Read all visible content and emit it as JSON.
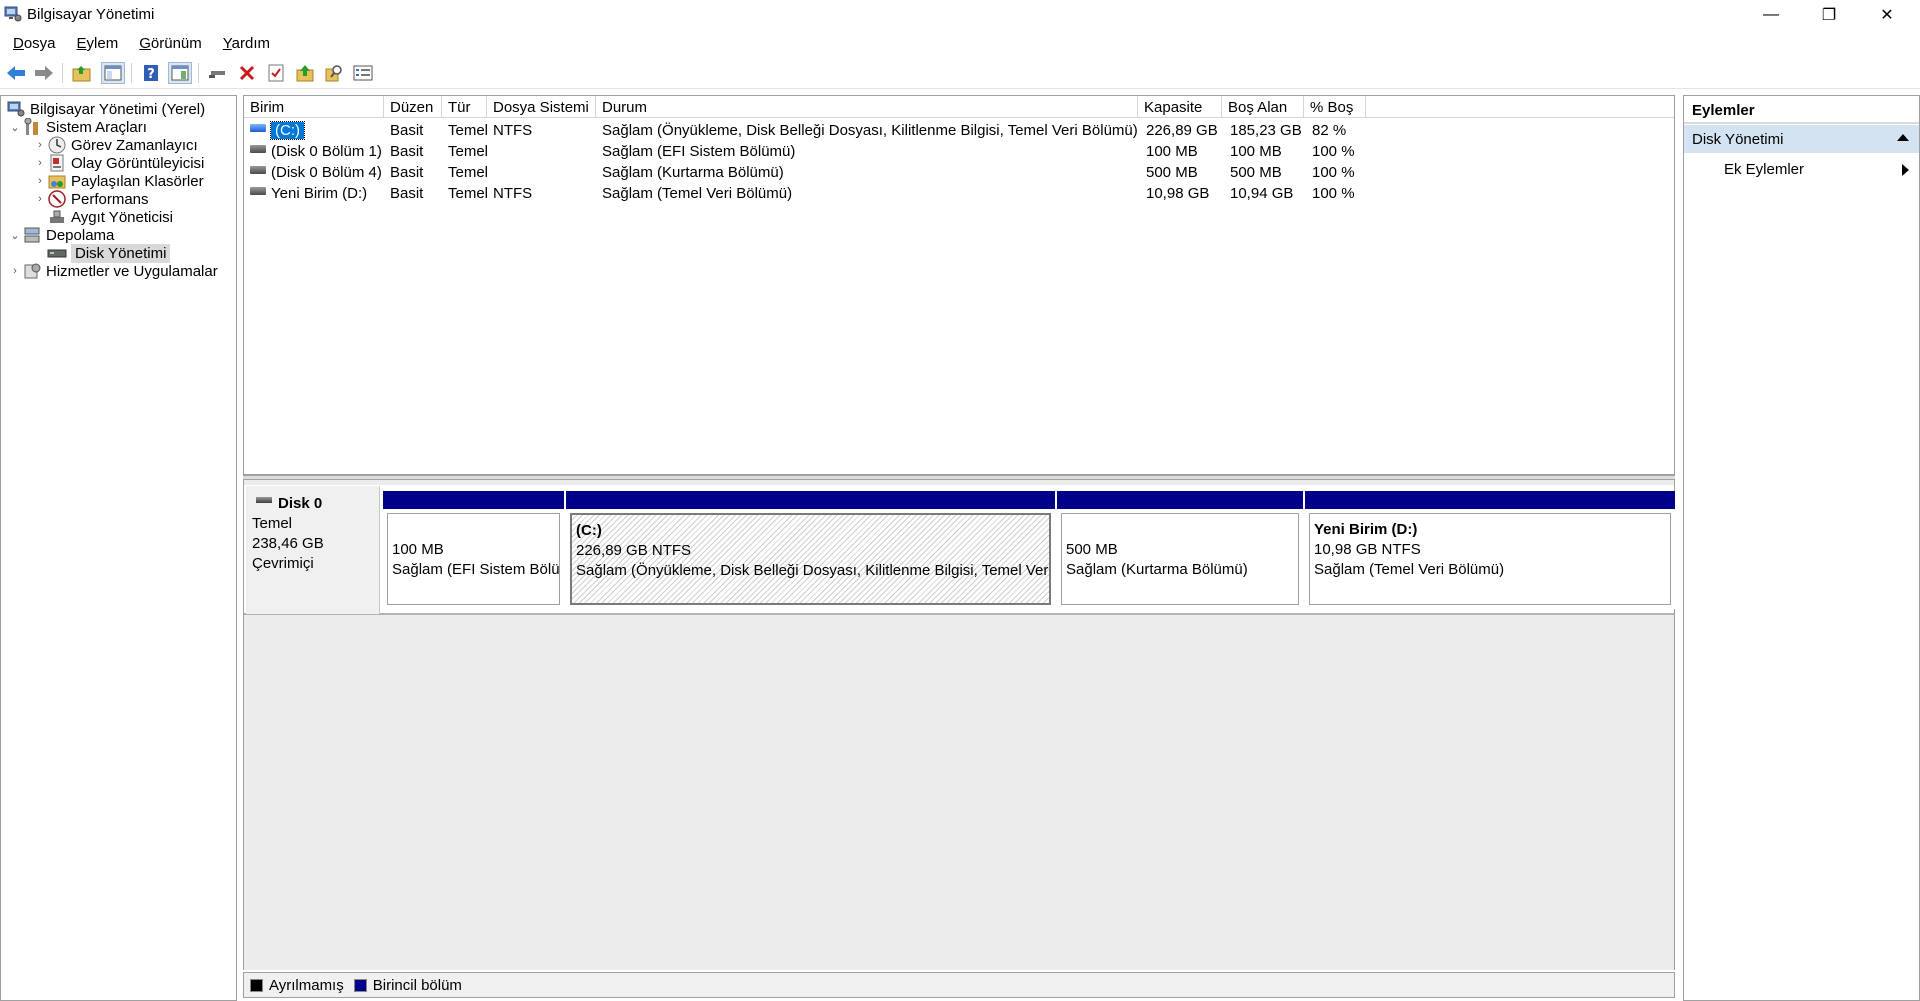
{
  "window": {
    "title": "Bilgisayar Yönetimi",
    "minimize_glyph": "—",
    "maximize_glyph": "❐",
    "close_glyph": "✕"
  },
  "menu": {
    "items": [
      {
        "underline": "D",
        "rest": "osya"
      },
      {
        "underline": "E",
        "rest": "ylem"
      },
      {
        "underline": "G",
        "rest": "örünüm"
      },
      {
        "underline": "Y",
        "rest": "ardım"
      }
    ]
  },
  "toolbar": {
    "icons": [
      "back-icon",
      "forward-icon",
      "up-folder-icon",
      "show-hide-tree-icon",
      "help-icon",
      "show-hide-action-icon",
      "connect-icon",
      "delete-icon",
      "check-icon",
      "up-icon",
      "search-icon",
      "properties-icon"
    ]
  },
  "tree": {
    "root": "Bilgisayar Yönetimi (Yerel)",
    "system_tools": "Sistem Araçları",
    "task_scheduler": "Görev Zamanlayıcı",
    "event_viewer": "Olay Görüntüleyicisi",
    "shared_folders": "Paylaşılan Klasörler",
    "performance": "Performans",
    "device_manager": "Aygıt Yöneticisi",
    "storage": "Depolama",
    "disk_management": "Disk Yönetimi",
    "services": "Hizmetler ve Uygulamalar",
    "chevron_open": "⌄",
    "chevron_closed": "›"
  },
  "volumes": {
    "headers": [
      "Birim",
      "Düzen",
      "Tür",
      "Dosya Sistemi",
      "Durum",
      "Kapasite",
      "Boş Alan",
      "% Boş"
    ],
    "rows": [
      {
        "name": "(C:)",
        "layout": "Basit",
        "type": "Temel",
        "fs": "NTFS",
        "status": "Sağlam (Önyükleme, Disk Belleği Dosyası, Kilitlenme Bilgisi, Temel Veri Bölümü)",
        "capacity": "226,89 GB",
        "free": "185,23 GB",
        "pct": "82 %"
      },
      {
        "name": "(Disk 0 Bölüm 1)",
        "layout": "Basit",
        "type": "Temel",
        "fs": "",
        "status": "Sağlam (EFI Sistem Bölümü)",
        "capacity": "100 MB",
        "free": "100 MB",
        "pct": "100 %"
      },
      {
        "name": "(Disk 0 Bölüm 4)",
        "layout": "Basit",
        "type": "Temel",
        "fs": "",
        "status": "Sağlam (Kurtarma Bölümü)",
        "capacity": "500 MB",
        "free": "500 MB",
        "pct": "100 %"
      },
      {
        "name": "Yeni Birim (D:)",
        "layout": "Basit",
        "type": "Temel",
        "fs": "NTFS",
        "status": "Sağlam (Temel Veri Bölümü)",
        "capacity": "10,98 GB",
        "free": "10,94 GB",
        "pct": "100 %"
      }
    ]
  },
  "disk": {
    "name": "Disk 0",
    "type": "Temel",
    "size": "238,46 GB",
    "state": "Çevrimiçi",
    "partitions": [
      {
        "name": "",
        "size": "100 MB",
        "status": "Sağlam (EFI Sistem Bölümü)"
      },
      {
        "name": "(C:)",
        "size": "226,89 GB NTFS",
        "status": "Sağlam (Önyükleme, Disk Belleği Dosyası, Kilitlenme Bilgisi, Temel Veri Bölümü)"
      },
      {
        "name": "",
        "size": "500 MB",
        "status": "Sağlam (Kurtarma Bölümü)"
      },
      {
        "name": "Yeni Birim  (D:)",
        "size": "10,98 GB NTFS",
        "status": "Sağlam (Temel Veri Bölümü)"
      }
    ]
  },
  "legend": {
    "unallocated": "Ayrılmamış",
    "primary": "Birincil bölüm",
    "unallocated_color": "#000000",
    "primary_color": "#00008b"
  },
  "actions": {
    "title": "Eylemler",
    "section": "Disk Yönetimi",
    "more": "Ek Eylemler"
  }
}
